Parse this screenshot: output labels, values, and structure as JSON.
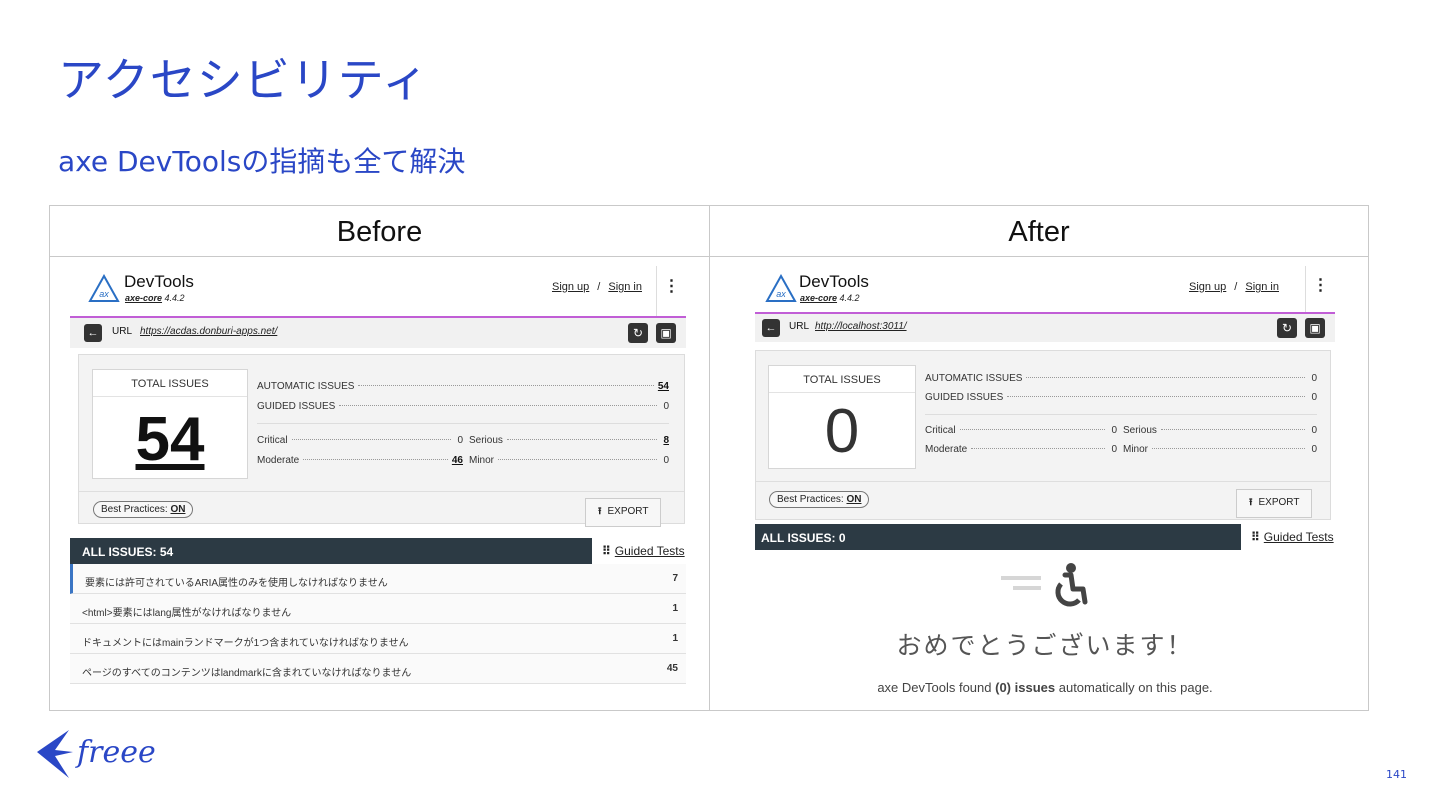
{
  "slide": {
    "title": "アクセシビリティ",
    "subtitle": "axe DevToolsの指摘も全て解決",
    "page_number": "141",
    "brand": "freee"
  },
  "columns": {
    "before": "Before",
    "after": "After"
  },
  "before": {
    "app_name": "DevTools",
    "core_name": "axe-core",
    "core_version": "4.4.2",
    "sign_up": "Sign up",
    "sign_in": "Sign in",
    "url_label": "URL",
    "url_value": "https://acdas.donburi-apps.net/",
    "total_label": "TOTAL ISSUES",
    "total": "54",
    "automatic_label": "AUTOMATIC ISSUES",
    "automatic": "54",
    "guided_label": "GUIDED ISSUES",
    "guided": "0",
    "critical_label": "Critical",
    "critical": "0",
    "serious_label": "Serious",
    "serious": "8",
    "moderate_label": "Moderate",
    "moderate": "46",
    "minor_label": "Minor",
    "minor": "0",
    "best_practices_label": "Best Practices:",
    "best_practices_value": "ON",
    "export_label": "EXPORT",
    "all_issues_label": "ALL ISSUES:",
    "all_issues_count": "54",
    "guided_tests_label": "Guided Tests",
    "issues": [
      {
        "text": "要素には許可されているARIA属性のみを使用しなければなりません",
        "count": "7"
      },
      {
        "text": "<html>要素にはlang属性がなければなりません",
        "count": "1"
      },
      {
        "text": "ドキュメントにはmainランドマークが1つ含まれていなければなりません",
        "count": "1"
      },
      {
        "text": "ページのすべてのコンテンツはlandmarkに含まれていなければなりません",
        "count": "45"
      }
    ]
  },
  "after": {
    "app_name": "DevTools",
    "core_name": "axe-core",
    "core_version": "4.4.2",
    "sign_up": "Sign up",
    "sign_in": "Sign in",
    "url_label": "URL",
    "url_value": "http://localhost:3011/",
    "total_label": "TOTAL ISSUES",
    "total": "0",
    "automatic_label": "AUTOMATIC ISSUES",
    "automatic": "0",
    "guided_label": "GUIDED ISSUES",
    "guided": "0",
    "critical_label": "Critical",
    "critical": "0",
    "serious_label": "Serious",
    "serious": "0",
    "moderate_label": "Moderate",
    "moderate": "0",
    "minor_label": "Minor",
    "minor": "0",
    "best_practices_label": "Best Practices:",
    "best_practices_value": "ON",
    "export_label": "EXPORT",
    "all_issues_label": "ALL ISSUES:",
    "all_issues_count": "0",
    "guided_tests_label": "Guided Tests",
    "congrats": "おめでとうございます！",
    "found_prefix": "axe DevTools found",
    "found_count": "(0) issues",
    "found_suffix": "automatically on this page."
  },
  "colors": {
    "brand_blue": "#2a47c6",
    "issues_bar": "#2c3a44",
    "url_accent": "#c15ed6"
  },
  "icons": [
    "axe-logo-icon",
    "kebab-menu-icon",
    "back-arrow-icon",
    "refresh-icon",
    "save-icon",
    "export-icon",
    "grid-icon",
    "wheelchair-icon",
    "freee-bird-icon"
  ]
}
